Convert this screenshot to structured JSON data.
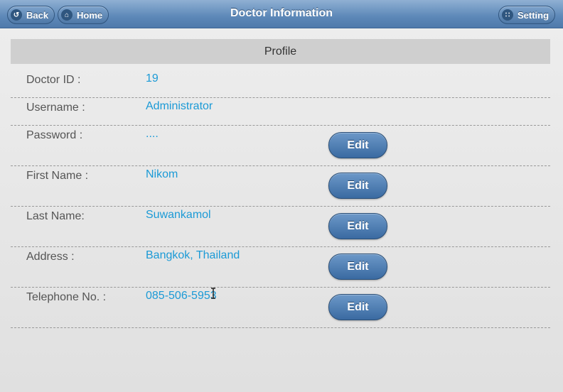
{
  "header": {
    "back_label": "Back",
    "home_label": "Home",
    "title": "Doctor Information",
    "setting_label": "Setting"
  },
  "profile": {
    "section_title": "Profile",
    "fields": [
      {
        "label": "Doctor ID :",
        "value": "19"
      },
      {
        "label": "Username :",
        "value": "Administrator"
      },
      {
        "label": "Password :",
        "value": "...."
      },
      {
        "label": "First Name :",
        "value": "Nikom"
      },
      {
        "label": "Last Name:",
        "value": "Suwankamol"
      },
      {
        "label": "Address :",
        "value": "Bangkok, Thailand"
      },
      {
        "label": "Telephone No. :",
        "value": "085-506-5953"
      }
    ],
    "edit_label": "Edit"
  },
  "icons": {
    "back": "back-arrow-icon",
    "home": "home-icon",
    "setting": "grid-icon"
  }
}
